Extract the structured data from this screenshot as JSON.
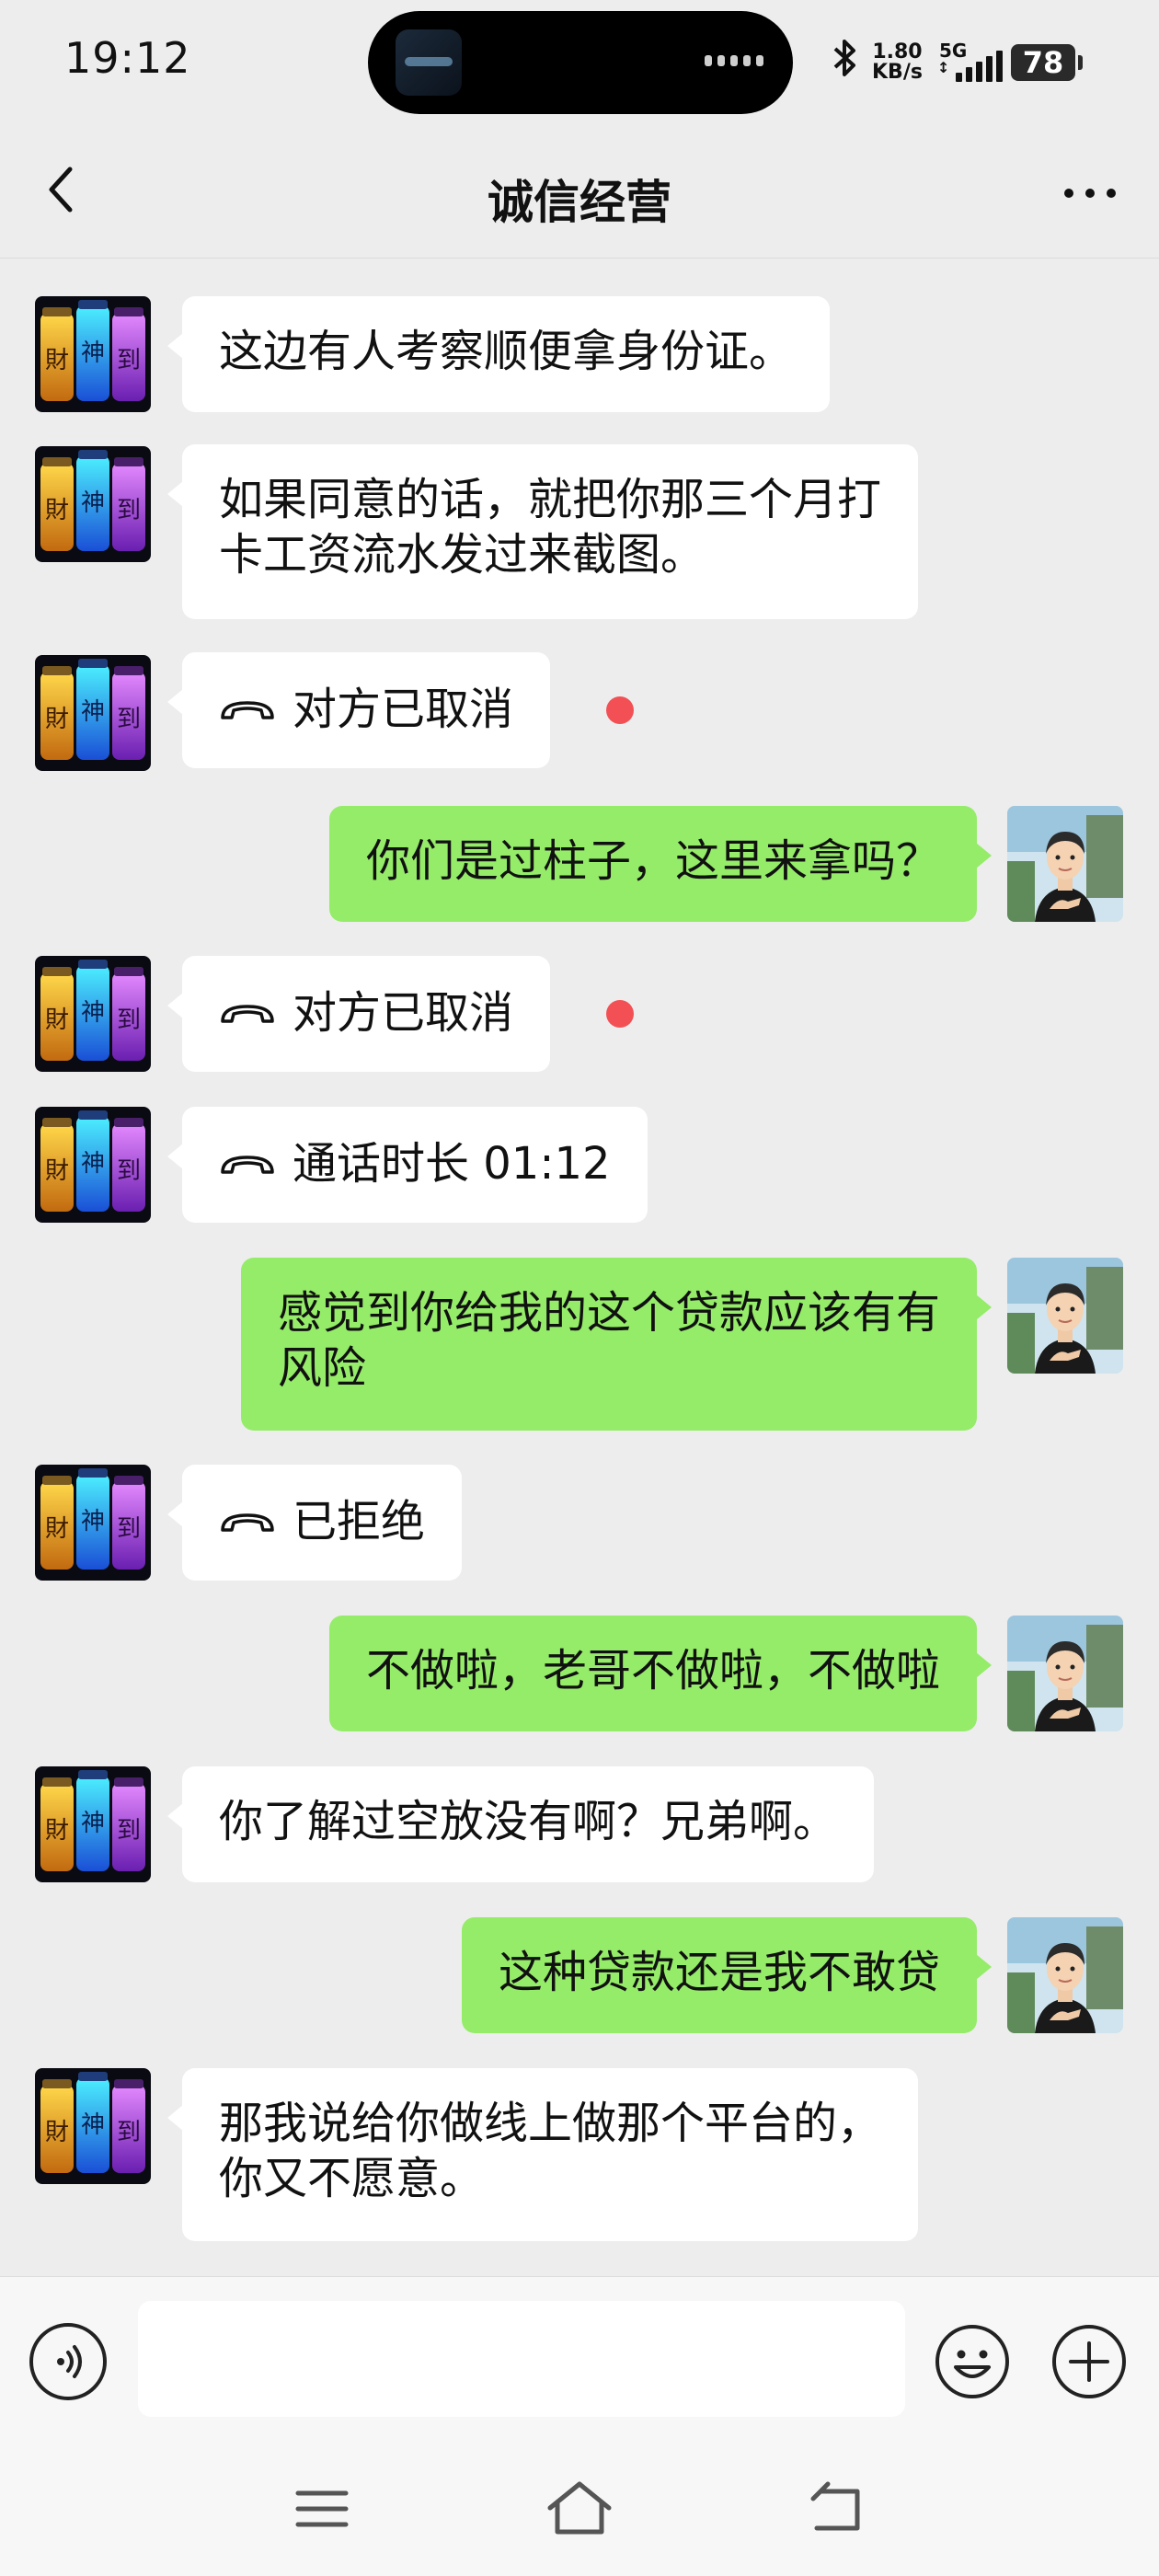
{
  "status_bar": {
    "time": "19:12",
    "net_speed_value": "1.80",
    "net_speed_unit": "KB/s",
    "network_type": "5G",
    "battery": "78"
  },
  "header": {
    "title": "诚信经营"
  },
  "colors": {
    "incoming_bubble": "#ffffff",
    "outgoing_bubble": "#95ec69",
    "unread_dot": "#f25055",
    "background": "#ededed"
  },
  "messages": [
    {
      "from": "contact",
      "type": "text",
      "text": "这边有人考察顺便拿身份证。"
    },
    {
      "from": "contact",
      "type": "text",
      "line1": "如果同意的话，就把你那三个月打",
      "line2": "卡工资流水发过来截图。"
    },
    {
      "from": "contact",
      "type": "call",
      "icon": "phone-hangup-icon",
      "text": "对方已取消",
      "unread": true
    },
    {
      "from": "me",
      "type": "text",
      "text": "你们是过柱子，这里来拿吗？"
    },
    {
      "from": "contact",
      "type": "call",
      "icon": "phone-hangup-icon",
      "text": "对方已取消",
      "unread": true
    },
    {
      "from": "contact",
      "type": "call",
      "icon": "phone-hangup-icon",
      "text": "通话时长 01:12"
    },
    {
      "from": "me",
      "type": "text",
      "line1": "感觉到你给我的这个贷款应该有有",
      "line2": "风险"
    },
    {
      "from": "contact",
      "type": "call",
      "icon": "phone-hangup-icon",
      "text": "已拒绝"
    },
    {
      "from": "me",
      "type": "text",
      "text": "不做啦，老哥不做啦，不做啦"
    },
    {
      "from": "contact",
      "type": "text",
      "text": "你了解过空放没有啊？兄弟啊。"
    },
    {
      "from": "me",
      "type": "text",
      "text": "这种贷款还是我不敢贷"
    },
    {
      "from": "contact",
      "type": "text",
      "line1": "那我说给你做线上做那个平台的，",
      "line2": "你又不愿意。"
    }
  ],
  "input_bar": {
    "value": "",
    "voice_icon": "voice-icon",
    "emoji_icon": "emoji-icon",
    "plus_icon": "plus-icon"
  },
  "system_nav": {
    "menu_icon": "menu-icon",
    "home_icon": "home-icon",
    "back_icon": "back-icon"
  }
}
